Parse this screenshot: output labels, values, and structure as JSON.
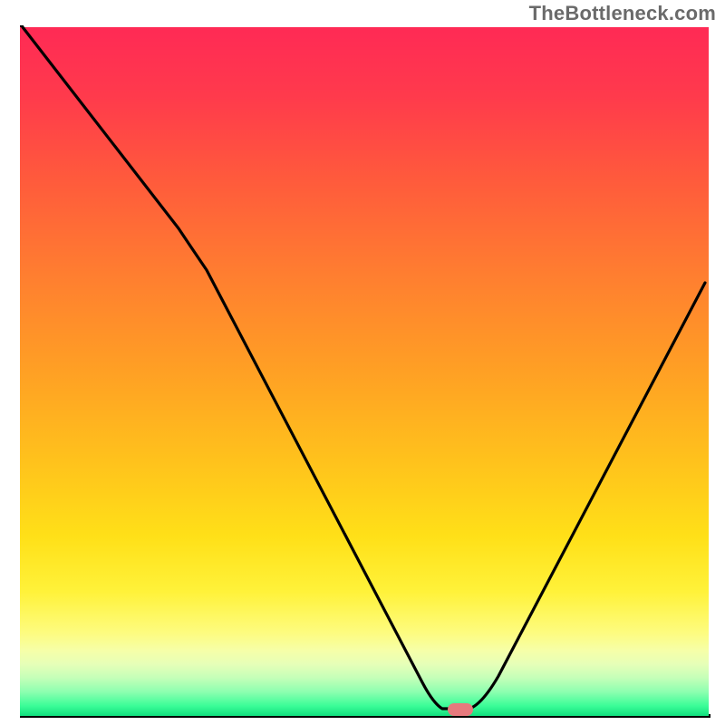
{
  "watermark": "TheBottleneck.com",
  "chart_data": {
    "type": "line",
    "title": "",
    "xlabel": "",
    "ylabel": "",
    "xlim": [
      0,
      100
    ],
    "ylim": [
      0,
      100
    ],
    "background_gradient": {
      "direction": "vertical",
      "stops": [
        {
          "pct": 0,
          "meaning": "worst",
          "color": "#ff2a55"
        },
        {
          "pct": 50,
          "meaning": "mid",
          "color": "#ffa024"
        },
        {
          "pct": 82,
          "meaning": "ok",
          "color": "#fff23a"
        },
        {
          "pct": 100,
          "meaning": "best",
          "color": "#11e07e"
        }
      ]
    },
    "series": [
      {
        "name": "bottleneck-curve",
        "color": "#000000",
        "x": [
          0,
          23,
          27,
          58,
          62,
          65,
          70,
          100
        ],
        "y": [
          100,
          71,
          65,
          5,
          1,
          1,
          6,
          63
        ]
      }
    ],
    "marker": {
      "name": "optimal-point",
      "shape": "pill",
      "color": "#e6797d",
      "x": 64,
      "y": 1
    }
  }
}
